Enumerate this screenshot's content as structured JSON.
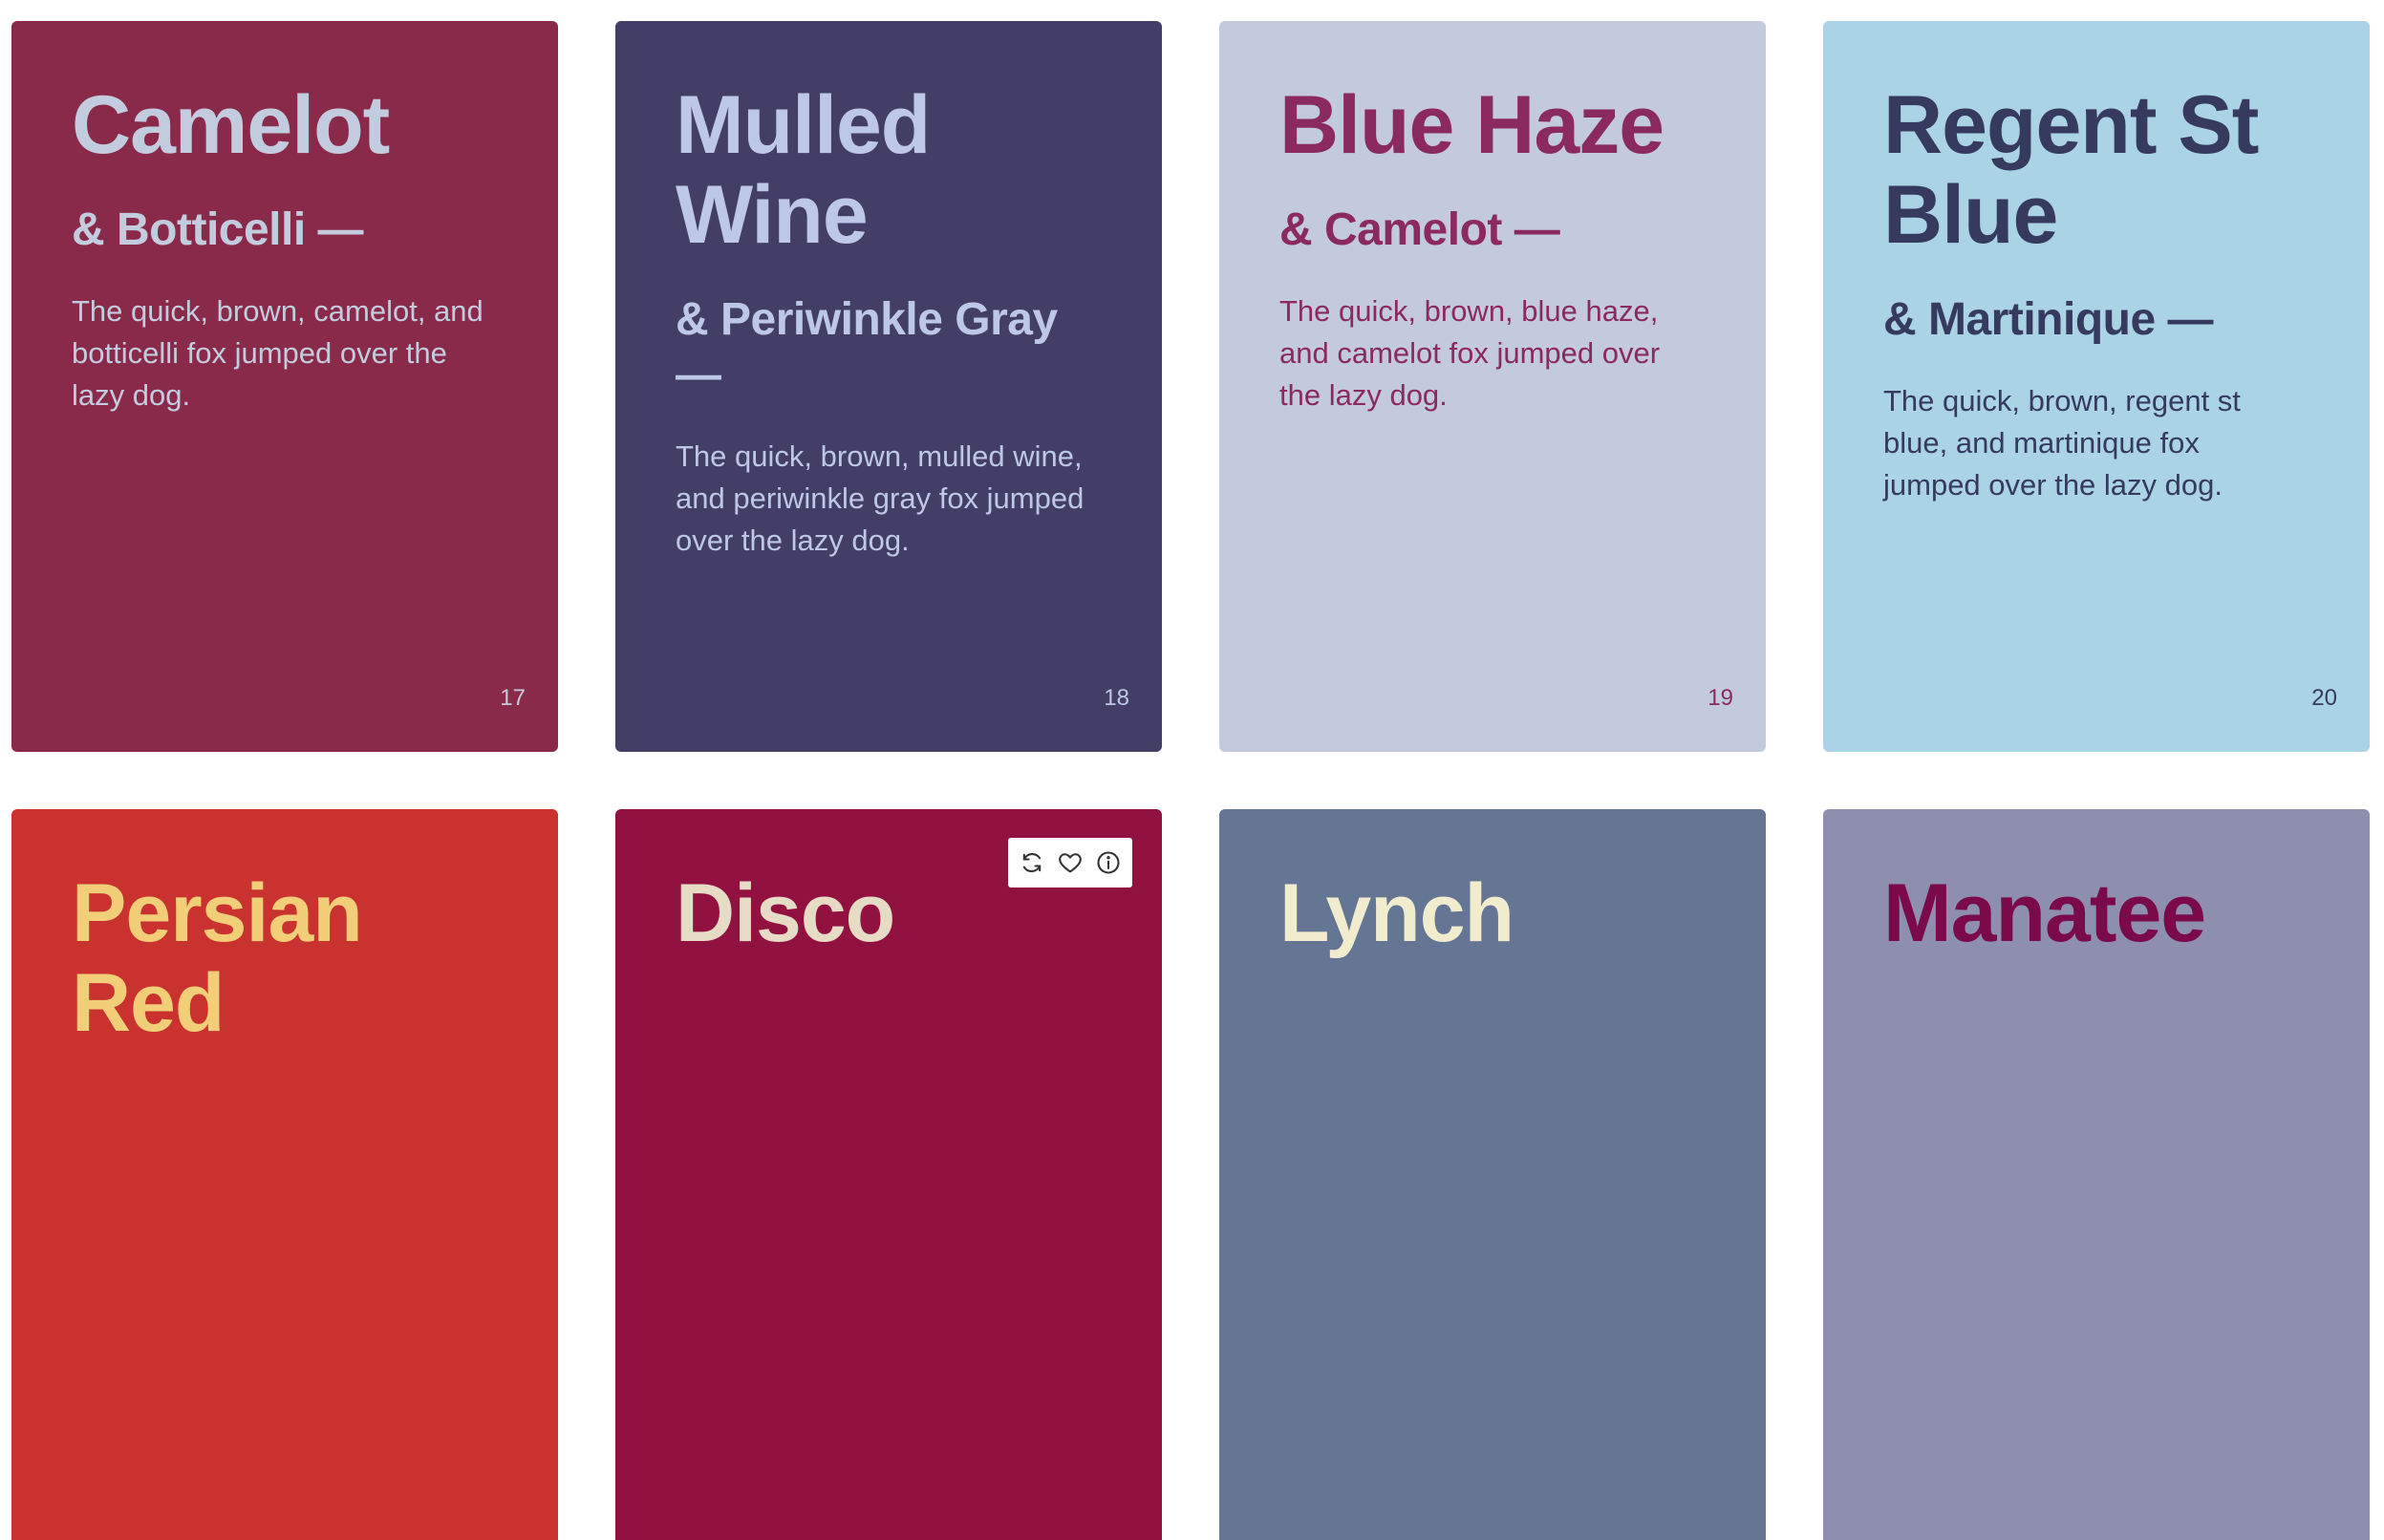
{
  "cards": [
    {
      "name": "Camelot",
      "pair": "& Botticelli —",
      "text": "The quick, brown, camelot, and botticelli fox jumped over the lazy dog.",
      "number": "17",
      "bg": "#8a2a4a",
      "fg": "#c3ccde"
    },
    {
      "name": "Mulled Wine",
      "pair": "& Periwinkle Gray —",
      "text": "The quick, brown, mulled wine, and periwinkle gray fox jumped over the lazy dog.",
      "number": "18",
      "bg": "#433e66",
      "fg": "#bdc8e8"
    },
    {
      "name": "Blue Haze",
      "pair": "& Camelot —",
      "text": "The quick, brown, blue haze, and camelot fox jumped over the lazy dog.",
      "number": "19",
      "bg": "#c3cadd",
      "fg": "#8a2a5e"
    },
    {
      "name": "Regent St Blue",
      "pair": "& Martinique —",
      "text": "The quick, brown, regent st blue, and martinique fox jumped over the lazy dog.",
      "number": "20",
      "bg": "#aad3e6",
      "fg": "#363a5e"
    },
    {
      "name": "Persian Red",
      "bg": "#c9322f",
      "fg": "#f1ce77"
    },
    {
      "name": "Disco",
      "bg": "#911241",
      "fg": "#e6dbc5",
      "toolbar": {
        "icons": [
          "refresh-icon",
          "heart-icon",
          "info-icon"
        ]
      }
    },
    {
      "name": "Lynch",
      "bg": "#657695",
      "fg": "#f2eccf"
    },
    {
      "name": "Manatee",
      "bg": "#8e8faf",
      "fg": "#7b0a4a"
    }
  ]
}
